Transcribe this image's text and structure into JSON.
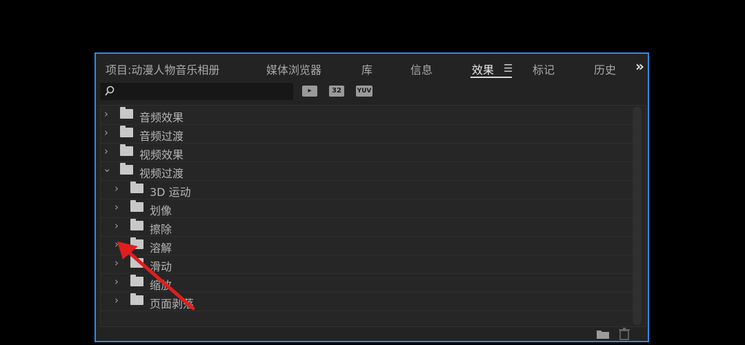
{
  "tabs": [
    {
      "label": "项目:动漫人物音乐相册"
    },
    {
      "label": "媒体浏览器"
    },
    {
      "label": "库"
    },
    {
      "label": "信息"
    },
    {
      "label": "效果"
    },
    {
      "label": "标记"
    },
    {
      "label": "历史"
    }
  ],
  "search": {
    "value": "",
    "placeholder": ""
  },
  "filters": [
    {
      "label": "",
      "icon": "accelerated-effects-icon"
    },
    {
      "label": "32",
      "icon": "32bit-color-icon"
    },
    {
      "label": "YUV",
      "icon": "yuv-effects-icon"
    }
  ],
  "tree": [
    {
      "label": "音频效果",
      "expanded": false,
      "level": 0
    },
    {
      "label": "音频过渡",
      "expanded": false,
      "level": 0
    },
    {
      "label": "视频效果",
      "expanded": false,
      "level": 0
    },
    {
      "label": "视频过渡",
      "expanded": true,
      "level": 0
    },
    {
      "label": "3D 运动",
      "expanded": false,
      "level": 1
    },
    {
      "label": "划像",
      "expanded": false,
      "level": 1
    },
    {
      "label": "擦除",
      "expanded": false,
      "level": 1
    },
    {
      "label": "溶解",
      "expanded": false,
      "level": 1
    },
    {
      "label": "滑动",
      "expanded": false,
      "level": 1
    },
    {
      "label": "缩放",
      "expanded": false,
      "level": 1
    },
    {
      "label": "页面剥落",
      "expanded": false,
      "level": 1
    }
  ],
  "colors": {
    "panel_border": "#2d8ceb",
    "annotation_arrow": "#e01e1e"
  }
}
